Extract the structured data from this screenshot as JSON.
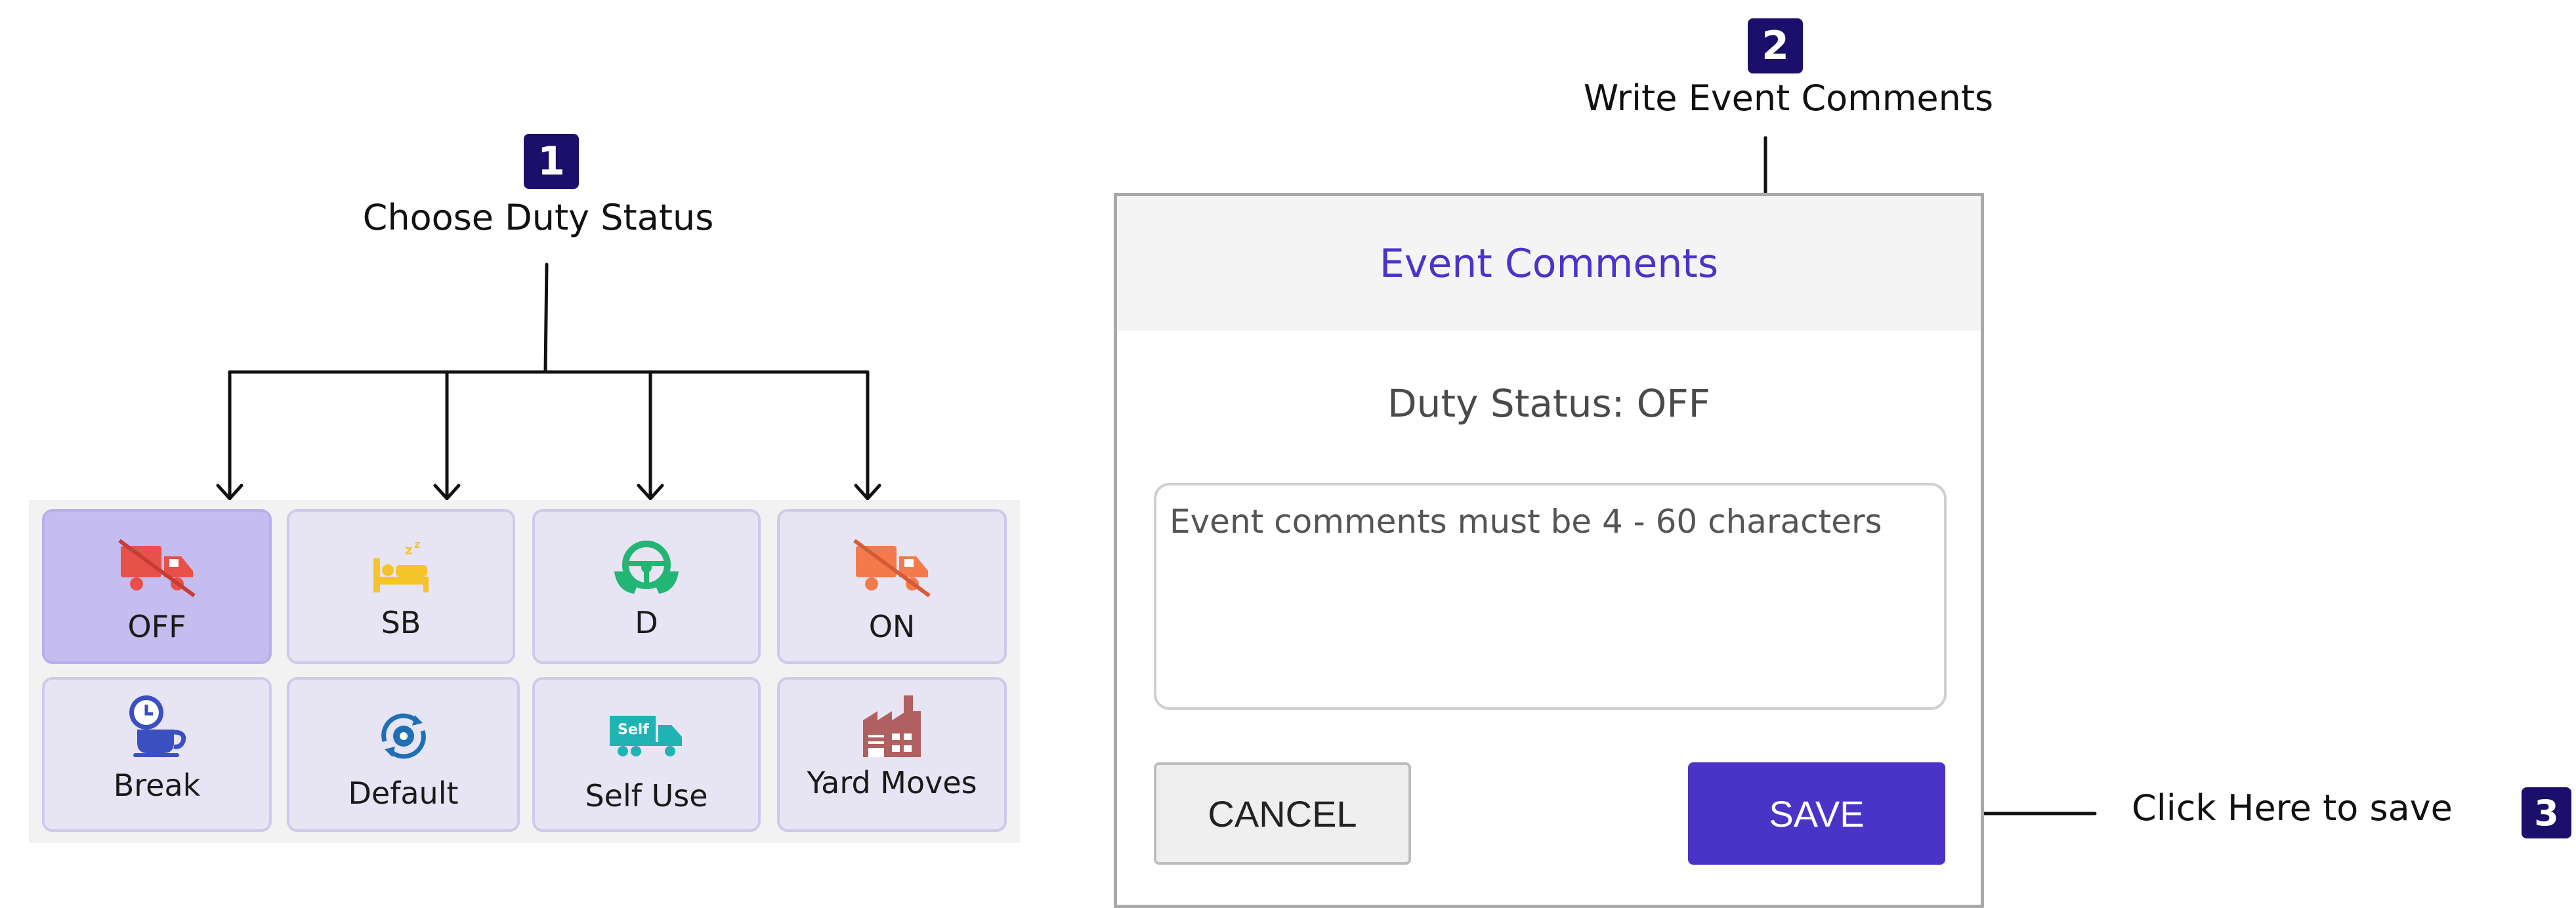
{
  "steps": [
    {
      "number": "1",
      "caption": "Choose Duty Status"
    },
    {
      "number": "2",
      "caption": "Write Event Comments"
    },
    {
      "number": "3",
      "caption": "Click Here to save"
    }
  ],
  "duty_tiles": [
    {
      "label": "OFF",
      "icon": "truck-off-icon",
      "color": "#e8504a",
      "selected": true
    },
    {
      "label": "SB",
      "icon": "sleeper-bed-icon",
      "color": "#f5c42a",
      "selected": false
    },
    {
      "label": "D",
      "icon": "steering-wheel-icon",
      "color": "#22b573",
      "selected": false
    },
    {
      "label": "ON",
      "icon": "truck-on-icon",
      "color": "#f47a4c",
      "selected": false
    },
    {
      "label": "Break",
      "icon": "coffee-break-icon",
      "color": "#3a4fc0",
      "selected": false
    },
    {
      "label": "Default",
      "icon": "gear-cycle-icon",
      "color": "#1f6fb5",
      "selected": false
    },
    {
      "label": "Self Use",
      "icon": "self-truck-icon",
      "color": "#1fb3b3",
      "badge_text": "Self",
      "selected": false
    },
    {
      "label": "Yard Moves",
      "icon": "factory-icon",
      "color": "#b06060",
      "selected": false
    }
  ],
  "dialog": {
    "title": "Event Comments",
    "duty_status": "Duty Status: OFF",
    "comments_placeholder": "Event comments must be 4 - 60 characters",
    "comments_value": "",
    "cancel_label": "CANCEL",
    "save_label": "SAVE"
  },
  "colors": {
    "badge": "#1b0f6b",
    "accent": "#4a34c8",
    "tile_bg": "#e7e4f3",
    "tile_selected_bg": "#c5bdf0"
  }
}
